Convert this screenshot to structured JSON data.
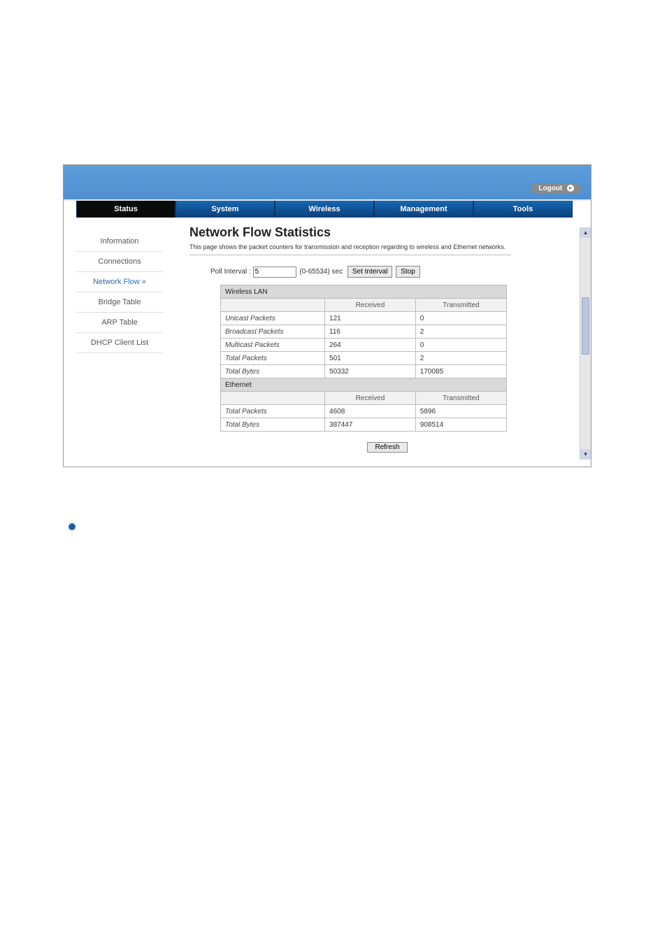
{
  "logout": {
    "label": "Logout"
  },
  "topnav": {
    "items": [
      {
        "label": "Status",
        "active": true
      },
      {
        "label": "System"
      },
      {
        "label": "Wireless"
      },
      {
        "label": "Management"
      },
      {
        "label": "Tools"
      }
    ]
  },
  "sidebar": {
    "items": [
      {
        "label": "Information"
      },
      {
        "label": "Connections"
      },
      {
        "label": "Network Flow  »",
        "active": true
      },
      {
        "label": "Bridge Table"
      },
      {
        "label": "ARP Table"
      },
      {
        "label": "DHCP Client List"
      }
    ]
  },
  "page": {
    "title": "Network Flow Statistics",
    "desc": "This page shows the packet counters for transmission and reception regarding to wireless and Ethernet networks."
  },
  "poll": {
    "label": "Poll Interval :",
    "value": "5",
    "range": "(0-65534) sec",
    "set_btn": "Set Interval",
    "stop_btn": "Stop"
  },
  "cols": {
    "received": "Received",
    "transmitted": "Transmitted"
  },
  "sections": {
    "wlan": {
      "title": "Wireless LAN",
      "rows": [
        {
          "label": "Unicast Packets",
          "rx": "121",
          "tx": "0"
        },
        {
          "label": "Broadcast Packets",
          "rx": "116",
          "tx": "2"
        },
        {
          "label": "Multicast Packets",
          "rx": "264",
          "tx": "0"
        },
        {
          "label": "Total Packets",
          "rx": "501",
          "tx": "2"
        },
        {
          "label": "Total Bytes",
          "rx": "50332",
          "tx": "170085"
        }
      ]
    },
    "eth": {
      "title": "Ethernet",
      "rows": [
        {
          "label": "Total Packets",
          "rx": "4608",
          "tx": "5896"
        },
        {
          "label": "Total Bytes",
          "rx": "387447",
          "tx": "908514"
        }
      ]
    }
  },
  "refresh": {
    "label": "Refresh"
  }
}
